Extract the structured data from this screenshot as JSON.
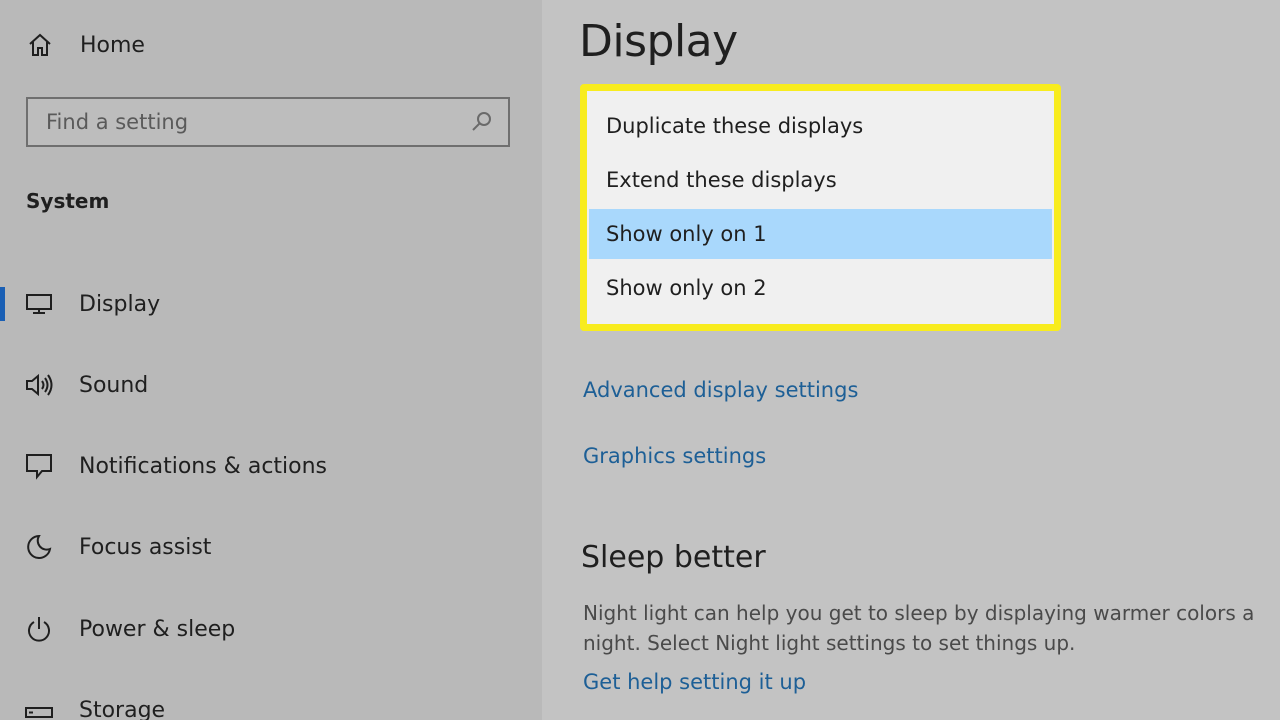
{
  "sidebar": {
    "home_label": "Home",
    "search_placeholder": "Find a setting",
    "section_title": "System",
    "items": [
      {
        "label": "Display",
        "icon": "monitor-icon",
        "active": true
      },
      {
        "label": "Sound",
        "icon": "speaker-icon",
        "active": false
      },
      {
        "label": "Notifications & actions",
        "icon": "notification-icon",
        "active": false
      },
      {
        "label": "Focus assist",
        "icon": "moon-icon",
        "active": false
      },
      {
        "label": "Power & sleep",
        "icon": "power-icon",
        "active": false
      },
      {
        "label": "Storage",
        "icon": "storage-icon",
        "active": false
      }
    ]
  },
  "main": {
    "title": "Display",
    "dropdown": {
      "options": [
        "Duplicate these displays",
        "Extend these displays",
        "Show only on 1",
        "Show only on 2"
      ],
      "selected_index": 2
    },
    "links": {
      "advanced": "Advanced display settings",
      "graphics": "Graphics settings"
    },
    "sleep": {
      "title": "Sleep better",
      "line1": "Night light can help you get to sleep by displaying warmer colors a",
      "line2": "night. Select Night light settings to set things up.",
      "help_link": "Get help setting it up"
    }
  },
  "colors": {
    "accent": "#1a5fb4",
    "link": "#1d5f96",
    "highlight_border": "#f8ec1e",
    "selected_option": "#a9d8fc"
  }
}
